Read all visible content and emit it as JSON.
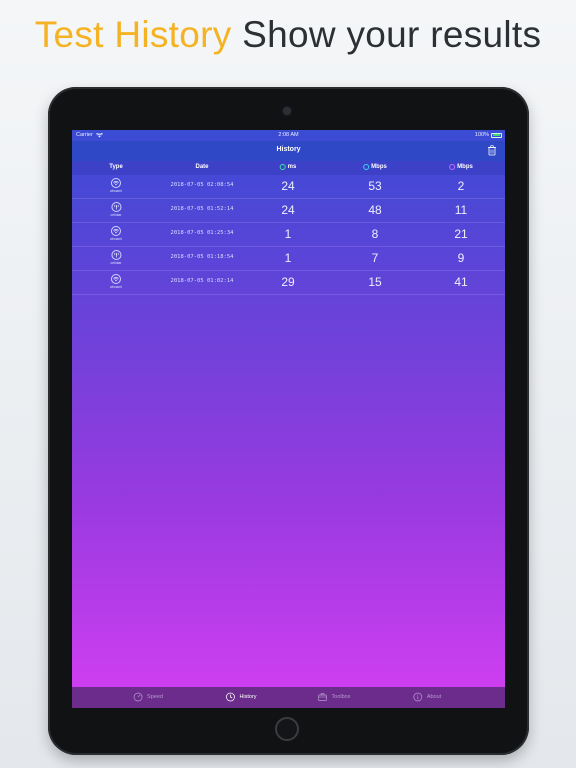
{
  "headline": {
    "accent": "Test History",
    "rest": " Show your results"
  },
  "status_bar": {
    "carrier": "Carrier",
    "time": "2:08 AM",
    "battery": "100%"
  },
  "nav": {
    "title": "History"
  },
  "table": {
    "headers": {
      "type": "Type",
      "date": "Date",
      "ping": "ms",
      "download": "Mbps",
      "upload": "Mbps"
    },
    "rows": [
      {
        "type": "wifi",
        "type_label": "whoami",
        "date": "2018-07-05 02:08:54",
        "ping": "24",
        "download": "53",
        "upload": "2"
      },
      {
        "type": "cellular",
        "type_label": "cellular",
        "date": "2018-07-05 01:52:14",
        "ping": "24",
        "download": "48",
        "upload": "11"
      },
      {
        "type": "wifi",
        "type_label": "whoami",
        "date": "2018-07-05 01:25:34",
        "ping": "1",
        "download": "8",
        "upload": "21"
      },
      {
        "type": "cellular",
        "type_label": "cellular",
        "date": "2018-07-05 01:18:54",
        "ping": "1",
        "download": "7",
        "upload": "9"
      },
      {
        "type": "wifi",
        "type_label": "whoami",
        "date": "2018-07-05 01:02:14",
        "ping": "29",
        "download": "15",
        "upload": "41"
      }
    ]
  },
  "tabs": [
    {
      "label": "Speed",
      "icon": "gauge-icon",
      "active": false
    },
    {
      "label": "History",
      "icon": "clock-icon",
      "active": true
    },
    {
      "label": "Toolbox",
      "icon": "toolbox-icon",
      "active": false
    },
    {
      "label": "About",
      "icon": "info-icon",
      "active": false
    }
  ],
  "colors": {
    "accent": "#f5b324",
    "ping_dot": "#3fe0a0",
    "download_dot": "#3fd0f0",
    "upload_dot": "#c070ff"
  }
}
